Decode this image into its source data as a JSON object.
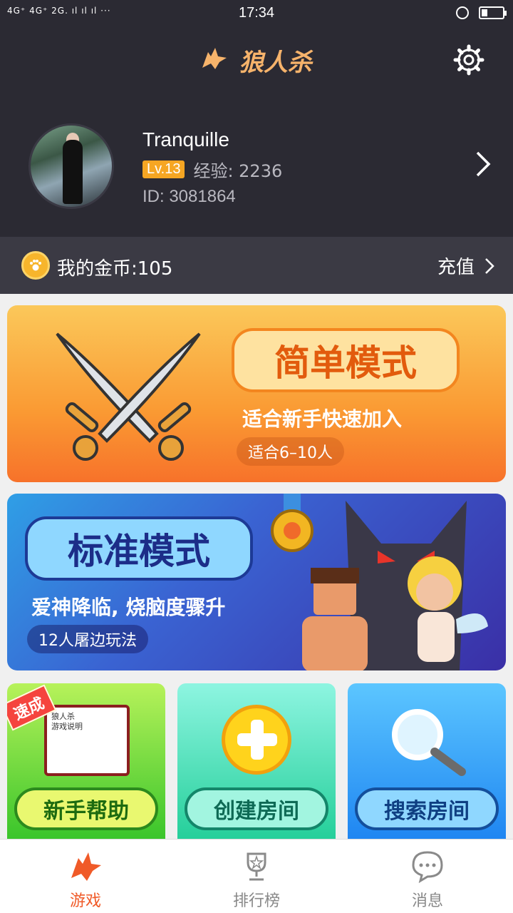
{
  "status_bar": {
    "network": "4G⁺ 4G⁺ 2G. ıl ıl ıl ···",
    "time": "17:34",
    "battery_level": 0.3
  },
  "header": {
    "app_title": "狼人杀",
    "settings_icon": "gear-icon"
  },
  "profile": {
    "username": "Tranquille",
    "level": "Lv.13",
    "exp": "经验: 2236",
    "user_id": "ID: 3081864"
  },
  "coins": {
    "label": "我的金币:105",
    "recharge": "充值"
  },
  "modes": {
    "simple": {
      "title": "简单模式",
      "subtitle": "适合新手快速加入",
      "pill": "适合6–10人"
    },
    "standard": {
      "title": "标准模式",
      "subtitle": "爱神降临, 烧脑度骤升",
      "pill": "12人屠边玩法"
    }
  },
  "quick_actions": {
    "help": {
      "label": "新手帮助",
      "ribbon": "速成",
      "book_title": "狼人杀\n游戏说明"
    },
    "create": {
      "label": "创建房间"
    },
    "search": {
      "label": "搜索房间"
    }
  },
  "tabs": [
    {
      "label": "游戏",
      "icon": "wolf-icon",
      "active": true
    },
    {
      "label": "排行榜",
      "icon": "trophy-icon",
      "active": false
    },
    {
      "label": "消息",
      "icon": "chat-bubble-icon",
      "active": false
    }
  ],
  "colors": {
    "accent": "#f05a28",
    "header_bg": "#2b2a33",
    "title_gold": "#f6b36b"
  }
}
